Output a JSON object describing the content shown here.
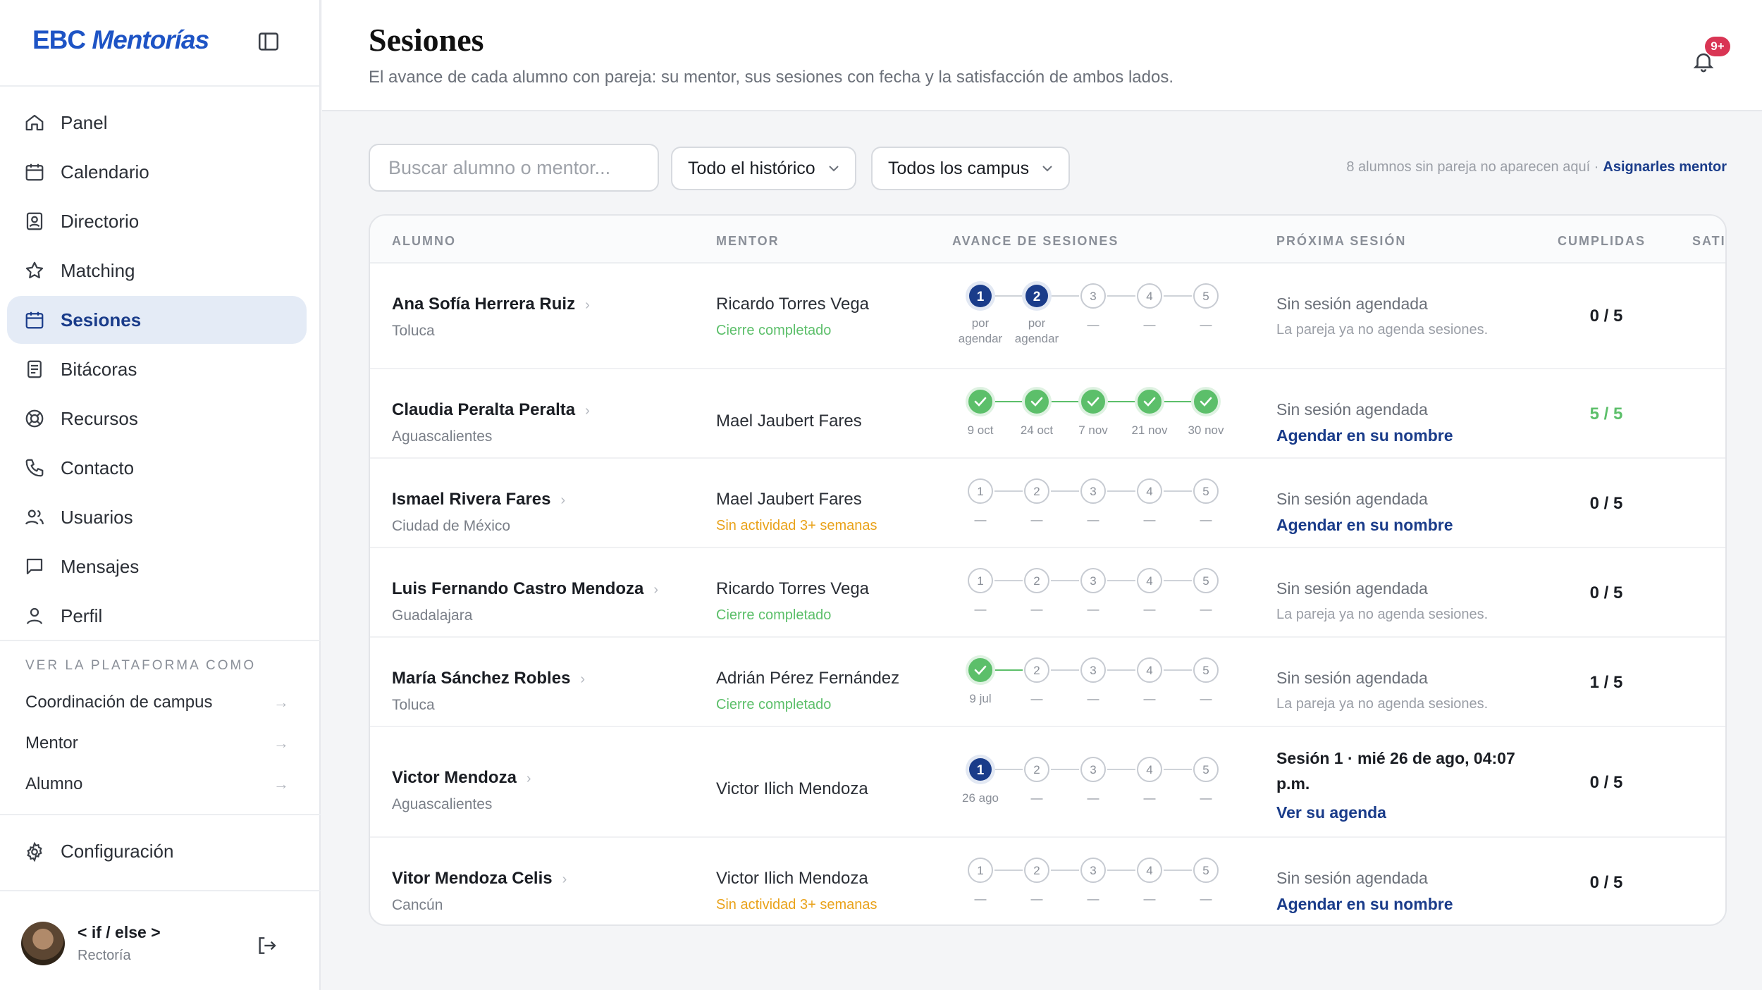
{
  "brand": {
    "part1": "EBC",
    "part2": "Mentorías"
  },
  "nav": [
    {
      "label": "Panel",
      "icon": "home-icon"
    },
    {
      "label": "Calendario",
      "icon": "calendar-icon"
    },
    {
      "label": "Directorio",
      "icon": "directory-icon"
    },
    {
      "label": "Matching",
      "icon": "star-icon"
    },
    {
      "label": "Sesiones",
      "icon": "calendar-icon",
      "active": true
    },
    {
      "label": "Bitácoras",
      "icon": "document-icon"
    },
    {
      "label": "Recursos",
      "icon": "lifebuoy-icon"
    },
    {
      "label": "Contacto",
      "icon": "phone-icon"
    },
    {
      "label": "Usuarios",
      "icon": "users-icon"
    },
    {
      "label": "Mensajes",
      "icon": "message-icon"
    },
    {
      "label": "Perfil",
      "icon": "user-icon"
    }
  ],
  "view_as": {
    "title": "VER LA PLATAFORMA COMO",
    "items": [
      "Coordinación de campus",
      "Mentor",
      "Alumno"
    ]
  },
  "config_label": "Configuración",
  "user": {
    "name": "< if / else >",
    "role": "Rectoría"
  },
  "header": {
    "title": "Sesiones",
    "subtitle": "El avance de cada alumno con pareja: su mentor, sus sesiones con fecha y la satisfacción de ambos lados.",
    "badge": "9+"
  },
  "toolbar": {
    "search_placeholder": "Buscar alumno o mentor...",
    "period": "Todo el histórico",
    "campus": "Todos los campus",
    "note": "8 alumnos sin pareja no aparecen aquí ·",
    "note_link": "Asignarles mentor"
  },
  "columns": [
    "ALUMNO",
    "MENTOR",
    "AVANCE DE SESIONES",
    "PRÓXIMA SESIÓN",
    "CUMPLIDAS",
    "SATI"
  ],
  "colors": {
    "primary": "#1a3c8a",
    "success": "#5cbf6a",
    "warning": "#e9a21a",
    "danger": "#d93554"
  },
  "rows": [
    {
      "student": "Ana Sofía Herrera Ruiz",
      "campus": "Toluca",
      "mentor": "Ricardo Torres Vega",
      "mentor_status": "Cierre completado",
      "status_kind": "success",
      "sessions": [
        {
          "n": "1",
          "state": "scheduled",
          "label": "por agendar"
        },
        {
          "n": "2",
          "state": "scheduled",
          "label": "por agendar"
        },
        {
          "n": "3",
          "state": "empty",
          "label": "—"
        },
        {
          "n": "4",
          "state": "empty",
          "label": "—"
        },
        {
          "n": "5",
          "state": "empty",
          "label": "—"
        }
      ],
      "next_title": "Sin sesión agendada",
      "next_sub": "La pareja ya no agenda sesiones.",
      "next_link": "",
      "done": "0 / 5"
    },
    {
      "student": "Claudia Peralta Peralta",
      "campus": "Aguascalientes",
      "mentor": "Mael Jaubert Fares",
      "mentor_status": "",
      "status_kind": "",
      "sessions": [
        {
          "n": "1",
          "state": "done",
          "label": "9 oct"
        },
        {
          "n": "2",
          "state": "done",
          "label": "24 oct"
        },
        {
          "n": "3",
          "state": "done",
          "label": "7 nov"
        },
        {
          "n": "4",
          "state": "done",
          "label": "21 nov"
        },
        {
          "n": "5",
          "state": "done",
          "label": "30 nov"
        }
      ],
      "next_title": "Sin sesión agendada",
      "next_sub": "",
      "next_link": "Agendar en su nombre",
      "done": "5 / 5"
    },
    {
      "student": "Ismael Rivera Fares",
      "campus": "Ciudad de México",
      "mentor": "Mael Jaubert Fares",
      "mentor_status": "Sin actividad 3+ semanas",
      "status_kind": "warning",
      "sessions": [
        {
          "n": "1",
          "state": "empty",
          "label": "—"
        },
        {
          "n": "2",
          "state": "empty",
          "label": "—"
        },
        {
          "n": "3",
          "state": "empty",
          "label": "—"
        },
        {
          "n": "4",
          "state": "empty",
          "label": "—"
        },
        {
          "n": "5",
          "state": "empty",
          "label": "—"
        }
      ],
      "next_title": "Sin sesión agendada",
      "next_sub": "",
      "next_link": "Agendar en su nombre",
      "done": "0 / 5"
    },
    {
      "student": "Luis Fernando Castro Mendoza",
      "campus": "Guadalajara",
      "mentor": "Ricardo Torres Vega",
      "mentor_status": "Cierre completado",
      "status_kind": "success",
      "sessions": [
        {
          "n": "1",
          "state": "empty",
          "label": "—"
        },
        {
          "n": "2",
          "state": "empty",
          "label": "—"
        },
        {
          "n": "3",
          "state": "empty",
          "label": "—"
        },
        {
          "n": "4",
          "state": "empty",
          "label": "—"
        },
        {
          "n": "5",
          "state": "empty",
          "label": "—"
        }
      ],
      "next_title": "Sin sesión agendada",
      "next_sub": "La pareja ya no agenda sesiones.",
      "next_link": "",
      "done": "0 / 5"
    },
    {
      "student": "María Sánchez Robles",
      "campus": "Toluca",
      "mentor": "Adrián Pérez Fernández",
      "mentor_status": "Cierre completado",
      "status_kind": "success",
      "sessions": [
        {
          "n": "1",
          "state": "done",
          "label": "9 jul"
        },
        {
          "n": "2",
          "state": "empty",
          "label": "—"
        },
        {
          "n": "3",
          "state": "empty",
          "label": "—"
        },
        {
          "n": "4",
          "state": "empty",
          "label": "—"
        },
        {
          "n": "5",
          "state": "empty",
          "label": "—"
        }
      ],
      "next_title": "Sin sesión agendada",
      "next_sub": "La pareja ya no agenda sesiones.",
      "next_link": "",
      "done": "1 / 5"
    },
    {
      "student": "Victor Mendoza",
      "campus": "Aguascalientes",
      "mentor": "Victor Ilich Mendoza",
      "mentor_status": "",
      "status_kind": "",
      "sessions": [
        {
          "n": "1",
          "state": "scheduled",
          "label": "26 ago"
        },
        {
          "n": "2",
          "state": "empty",
          "label": "—"
        },
        {
          "n": "3",
          "state": "empty",
          "label": "—"
        },
        {
          "n": "4",
          "state": "empty",
          "label": "—"
        },
        {
          "n": "5",
          "state": "empty",
          "label": "—"
        }
      ],
      "next_title": "Sesión 1 · mié 26 de ago, 04:07 p.m.",
      "next_bold": true,
      "next_sub": "",
      "next_link": "Ver su agenda",
      "done": "0 / 5"
    },
    {
      "student": "Vitor Mendoza Celis",
      "campus": "Cancún",
      "mentor": "Victor Ilich Mendoza",
      "mentor_status": "Sin actividad 3+ semanas",
      "status_kind": "warning",
      "sessions": [
        {
          "n": "1",
          "state": "empty",
          "label": "—"
        },
        {
          "n": "2",
          "state": "empty",
          "label": "—"
        },
        {
          "n": "3",
          "state": "empty",
          "label": "—"
        },
        {
          "n": "4",
          "state": "empty",
          "label": "—"
        },
        {
          "n": "5",
          "state": "empty",
          "label": "—"
        }
      ],
      "next_title": "Sin sesión agendada",
      "next_sub": "",
      "next_link": "Agendar en su nombre",
      "done": "0 / 5"
    }
  ]
}
